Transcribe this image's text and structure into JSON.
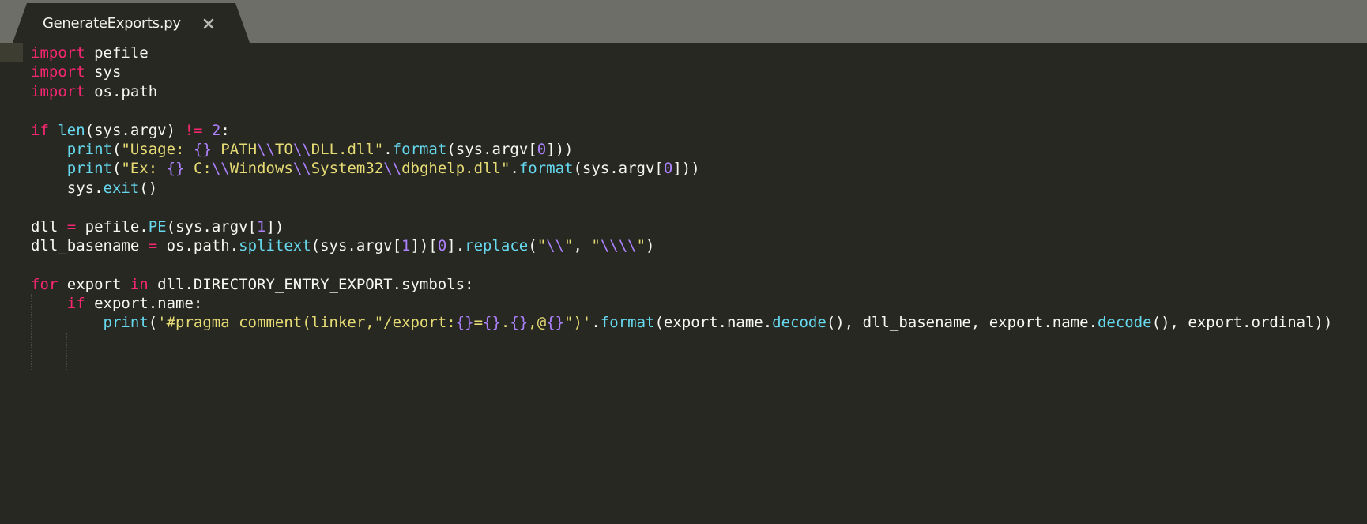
{
  "tab": {
    "title": "GenerateExports.py",
    "close_icon": "close-icon"
  },
  "colors": {
    "keyword": "#f92672",
    "function": "#66d9ef",
    "string": "#e6db74",
    "number": "#ae81ff",
    "text": "#f8f8f2",
    "background": "#272822",
    "tabbar": "#6d6e67"
  },
  "code": {
    "lines": [
      [
        {
          "t": "kw",
          "v": "import"
        },
        {
          "t": "plain",
          "v": " pefile"
        }
      ],
      [
        {
          "t": "kw",
          "v": "import"
        },
        {
          "t": "plain",
          "v": " sys"
        }
      ],
      [
        {
          "t": "kw",
          "v": "import"
        },
        {
          "t": "plain",
          "v": " os.path"
        }
      ],
      [],
      [
        {
          "t": "kw",
          "v": "if"
        },
        {
          "t": "plain",
          "v": " "
        },
        {
          "t": "fn",
          "v": "len"
        },
        {
          "t": "plain",
          "v": "(sys.argv) "
        },
        {
          "t": "kw",
          "v": "!="
        },
        {
          "t": "plain",
          "v": " "
        },
        {
          "t": "num",
          "v": "2"
        },
        {
          "t": "plain",
          "v": ":"
        }
      ],
      [
        {
          "t": "plain",
          "v": "    "
        },
        {
          "t": "fn",
          "v": "print"
        },
        {
          "t": "plain",
          "v": "("
        },
        {
          "t": "str",
          "v": "\"Usage: "
        },
        {
          "t": "num",
          "v": "{}"
        },
        {
          "t": "str",
          "v": " PATH"
        },
        {
          "t": "num",
          "v": "\\\\"
        },
        {
          "t": "str",
          "v": "TO"
        },
        {
          "t": "num",
          "v": "\\\\"
        },
        {
          "t": "str",
          "v": "DLL.dll\""
        },
        {
          "t": "plain",
          "v": "."
        },
        {
          "t": "fn",
          "v": "format"
        },
        {
          "t": "plain",
          "v": "(sys.argv["
        },
        {
          "t": "num",
          "v": "0"
        },
        {
          "t": "plain",
          "v": "]))"
        }
      ],
      [
        {
          "t": "plain",
          "v": "    "
        },
        {
          "t": "fn",
          "v": "print"
        },
        {
          "t": "plain",
          "v": "("
        },
        {
          "t": "str",
          "v": "\"Ex: "
        },
        {
          "t": "num",
          "v": "{}"
        },
        {
          "t": "str",
          "v": " C:"
        },
        {
          "t": "num",
          "v": "\\\\"
        },
        {
          "t": "str",
          "v": "Windows"
        },
        {
          "t": "num",
          "v": "\\\\"
        },
        {
          "t": "str",
          "v": "System32"
        },
        {
          "t": "num",
          "v": "\\\\"
        },
        {
          "t": "str",
          "v": "dbghelp.dll\""
        },
        {
          "t": "plain",
          "v": "."
        },
        {
          "t": "fn",
          "v": "format"
        },
        {
          "t": "plain",
          "v": "(sys.argv["
        },
        {
          "t": "num",
          "v": "0"
        },
        {
          "t": "plain",
          "v": "]))"
        }
      ],
      [
        {
          "t": "plain",
          "v": "    sys."
        },
        {
          "t": "fn",
          "v": "exit"
        },
        {
          "t": "plain",
          "v": "()"
        }
      ],
      [],
      [
        {
          "t": "plain",
          "v": "dll "
        },
        {
          "t": "kw",
          "v": "="
        },
        {
          "t": "plain",
          "v": " pefile."
        },
        {
          "t": "fn",
          "v": "PE"
        },
        {
          "t": "plain",
          "v": "(sys.argv["
        },
        {
          "t": "num",
          "v": "1"
        },
        {
          "t": "plain",
          "v": "])"
        }
      ],
      [
        {
          "t": "plain",
          "v": "dll_basename "
        },
        {
          "t": "kw",
          "v": "="
        },
        {
          "t": "plain",
          "v": " os.path."
        },
        {
          "t": "fn",
          "v": "splitext"
        },
        {
          "t": "plain",
          "v": "(sys.argv["
        },
        {
          "t": "num",
          "v": "1"
        },
        {
          "t": "plain",
          "v": "])["
        },
        {
          "t": "num",
          "v": "0"
        },
        {
          "t": "plain",
          "v": "]."
        },
        {
          "t": "fn",
          "v": "replace"
        },
        {
          "t": "plain",
          "v": "("
        },
        {
          "t": "str",
          "v": "\""
        },
        {
          "t": "num",
          "v": "\\\\"
        },
        {
          "t": "str",
          "v": "\""
        },
        {
          "t": "plain",
          "v": ", "
        },
        {
          "t": "str",
          "v": "\""
        },
        {
          "t": "num",
          "v": "\\\\\\\\"
        },
        {
          "t": "str",
          "v": "\""
        },
        {
          "t": "plain",
          "v": ")"
        }
      ],
      [],
      [
        {
          "t": "kw",
          "v": "for"
        },
        {
          "t": "plain",
          "v": " export "
        },
        {
          "t": "kw",
          "v": "in"
        },
        {
          "t": "plain",
          "v": " dll.DIRECTORY_ENTRY_EXPORT.symbols:"
        }
      ],
      [
        {
          "t": "plain",
          "v": "    "
        },
        {
          "t": "kw",
          "v": "if"
        },
        {
          "t": "plain",
          "v": " export.name:"
        }
      ],
      [
        {
          "t": "plain",
          "v": "        "
        },
        {
          "t": "fn",
          "v": "print"
        },
        {
          "t": "plain",
          "v": "("
        },
        {
          "t": "str",
          "v": "'#pragma comment(linker,\"/export:"
        },
        {
          "t": "num",
          "v": "{}"
        },
        {
          "t": "str",
          "v": "="
        },
        {
          "t": "num",
          "v": "{}"
        },
        {
          "t": "str",
          "v": "."
        },
        {
          "t": "num",
          "v": "{}"
        },
        {
          "t": "str",
          "v": ",@"
        },
        {
          "t": "num",
          "v": "{}"
        },
        {
          "t": "str",
          "v": "\")'"
        },
        {
          "t": "plain",
          "v": "."
        },
        {
          "t": "fn",
          "v": "format"
        },
        {
          "t": "plain",
          "v": "(export.name."
        },
        {
          "t": "fn",
          "v": "decode"
        },
        {
          "t": "plain",
          "v": "(), dll_basename, export.name."
        },
        {
          "t": "fn",
          "v": "decode"
        },
        {
          "t": "plain",
          "v": "(), export.ordinal))"
        }
      ]
    ]
  }
}
